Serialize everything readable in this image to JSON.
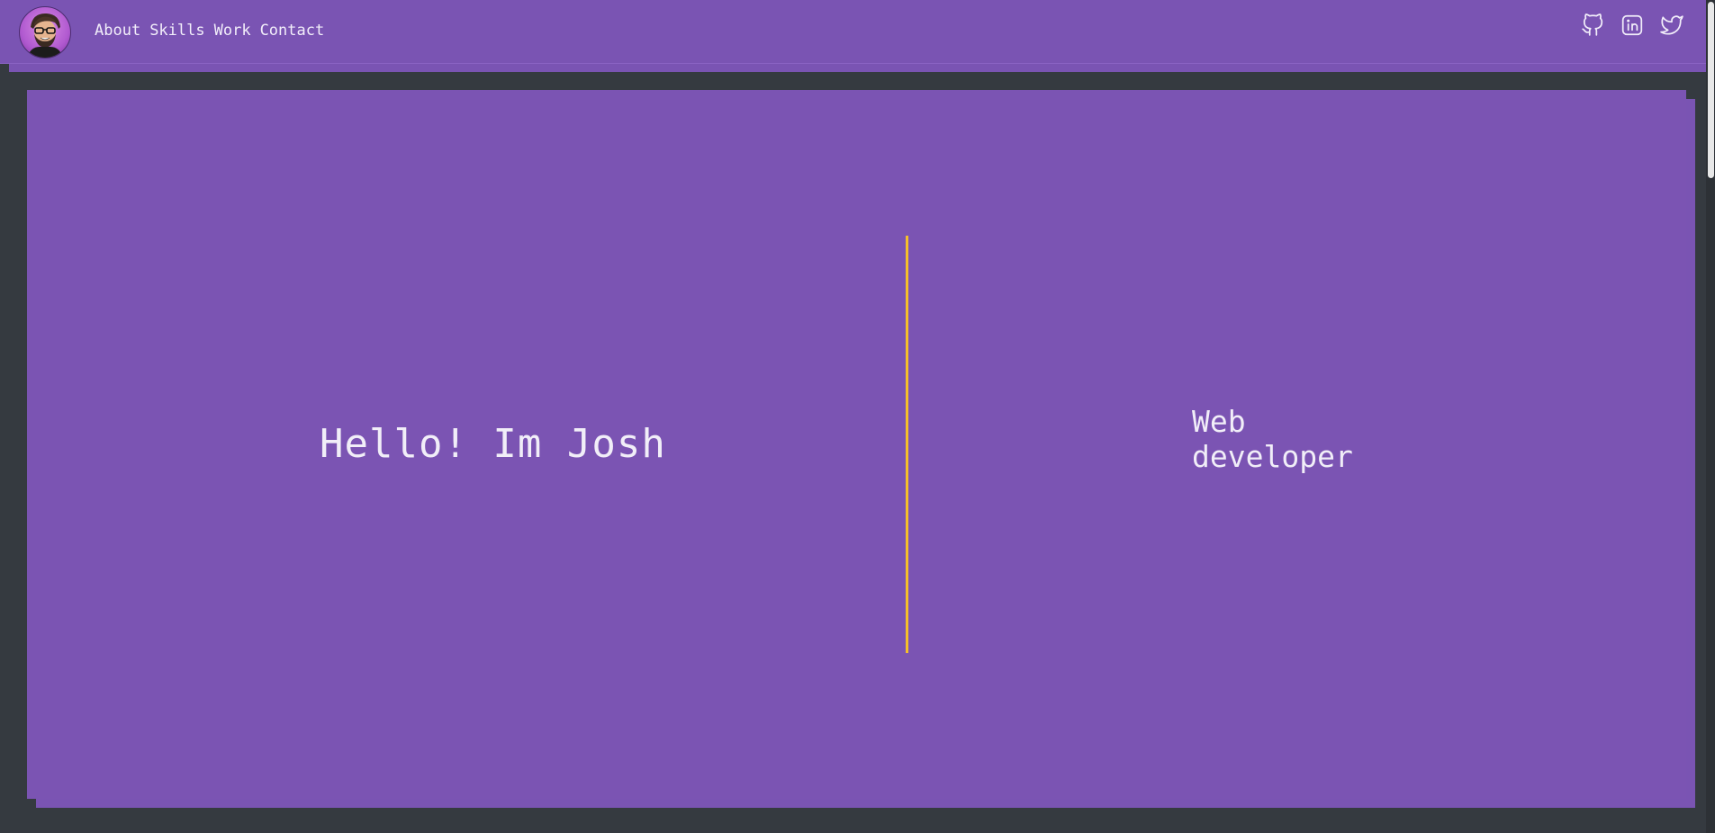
{
  "header": {
    "avatar_alt": "avatar",
    "nav": [
      "About",
      "Skills",
      "Work",
      "Contact"
    ],
    "social": [
      {
        "icon": "github-icon"
      },
      {
        "icon": "linkedin-icon"
      },
      {
        "icon": "twitter-icon"
      }
    ]
  },
  "hero": {
    "greeting": "Hello! Im Josh",
    "role_line1": "Web",
    "role_line2": "developer"
  },
  "colors": {
    "primary": "#7b54b3",
    "background": "#353a40",
    "accent": "#f5bf2a",
    "text": "#f1eef8"
  }
}
